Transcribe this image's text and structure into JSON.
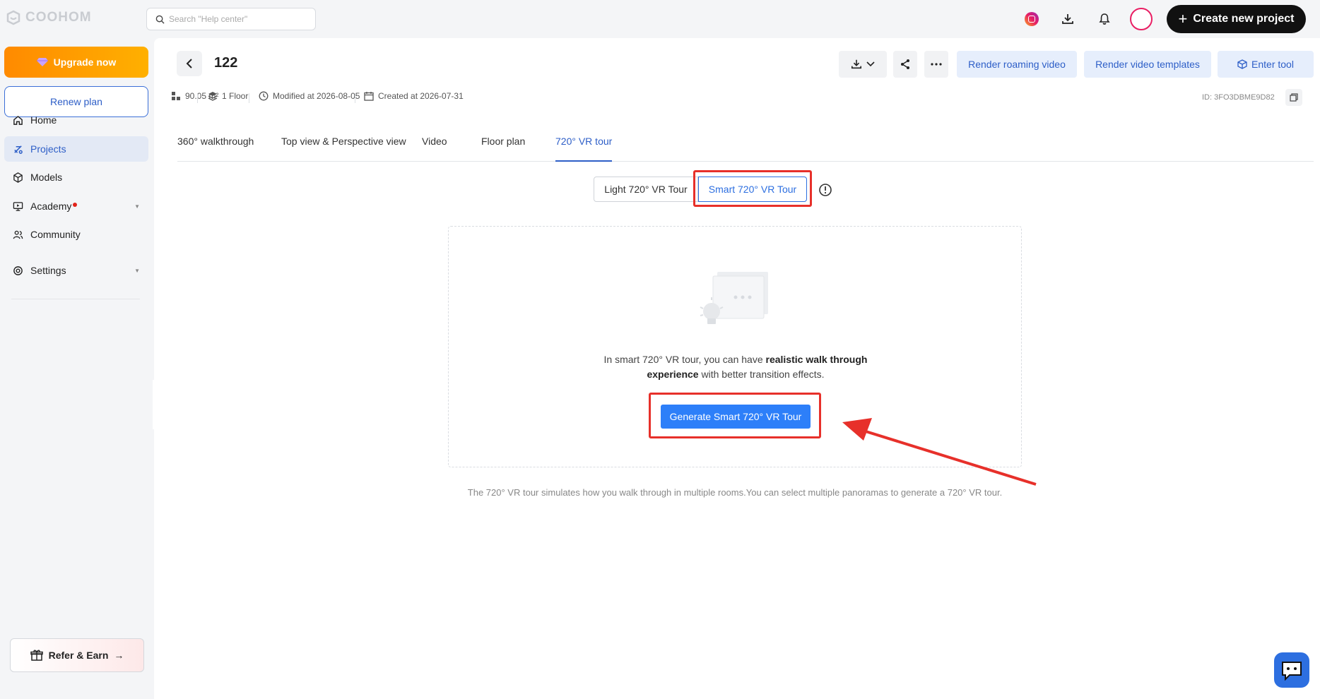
{
  "brand": {
    "name": "COOHOM"
  },
  "search": {
    "placeholder": "Search \"Help center\""
  },
  "header": {
    "create_label": "Create new project"
  },
  "sidebar": {
    "upgrade_label": "Upgrade now",
    "renew_label": "Renew plan",
    "items": [
      {
        "label": "Home",
        "icon": "home-icon"
      },
      {
        "label": "Projects",
        "icon": "projects-icon",
        "active": true
      },
      {
        "label": "Models",
        "icon": "cube-icon"
      },
      {
        "label": "Academy",
        "icon": "monitor-icon",
        "has_dot": true,
        "has_caret": true
      },
      {
        "label": "Community",
        "icon": "people-icon"
      },
      {
        "label": "Settings",
        "icon": "gear-icon",
        "has_caret": true
      }
    ],
    "refer_label": "Refer & Earn"
  },
  "project": {
    "title": "122",
    "area": "90.05 m²",
    "floors": "1 Floor",
    "modified": "Modified at 2026-08-05",
    "created": "Created at 2026-07-31",
    "id": "ID: 3FO3DBME9D82"
  },
  "toolbar": {
    "render_roaming": "Render roaming video",
    "render_templates": "Render video templates",
    "enter_tool": "Enter tool"
  },
  "tabs": [
    {
      "label": "360° walkthrough"
    },
    {
      "label": "Top view & Perspective view"
    },
    {
      "label": "Video"
    },
    {
      "label": "Floor plan"
    },
    {
      "label": "720° VR tour",
      "active": true
    }
  ],
  "vr": {
    "light_label": "Light 720° VR Tour",
    "smart_label": "Smart 720° VR Tour",
    "desc_prefix": "In smart 720° VR tour, you can have ",
    "desc_bold": "realistic walk through experience",
    "desc_suffix": " with better transition effects.",
    "generate_label": "Generate Smart 720° VR Tour",
    "footnote": "The 720° VR tour simulates how you walk through in multiple rooms.You can select multiple panoramas to generate a 720° VR tour."
  },
  "colors": {
    "accent": "#2d6fe0",
    "highlight": "#e7302a",
    "upgrade": "#ff9800"
  }
}
